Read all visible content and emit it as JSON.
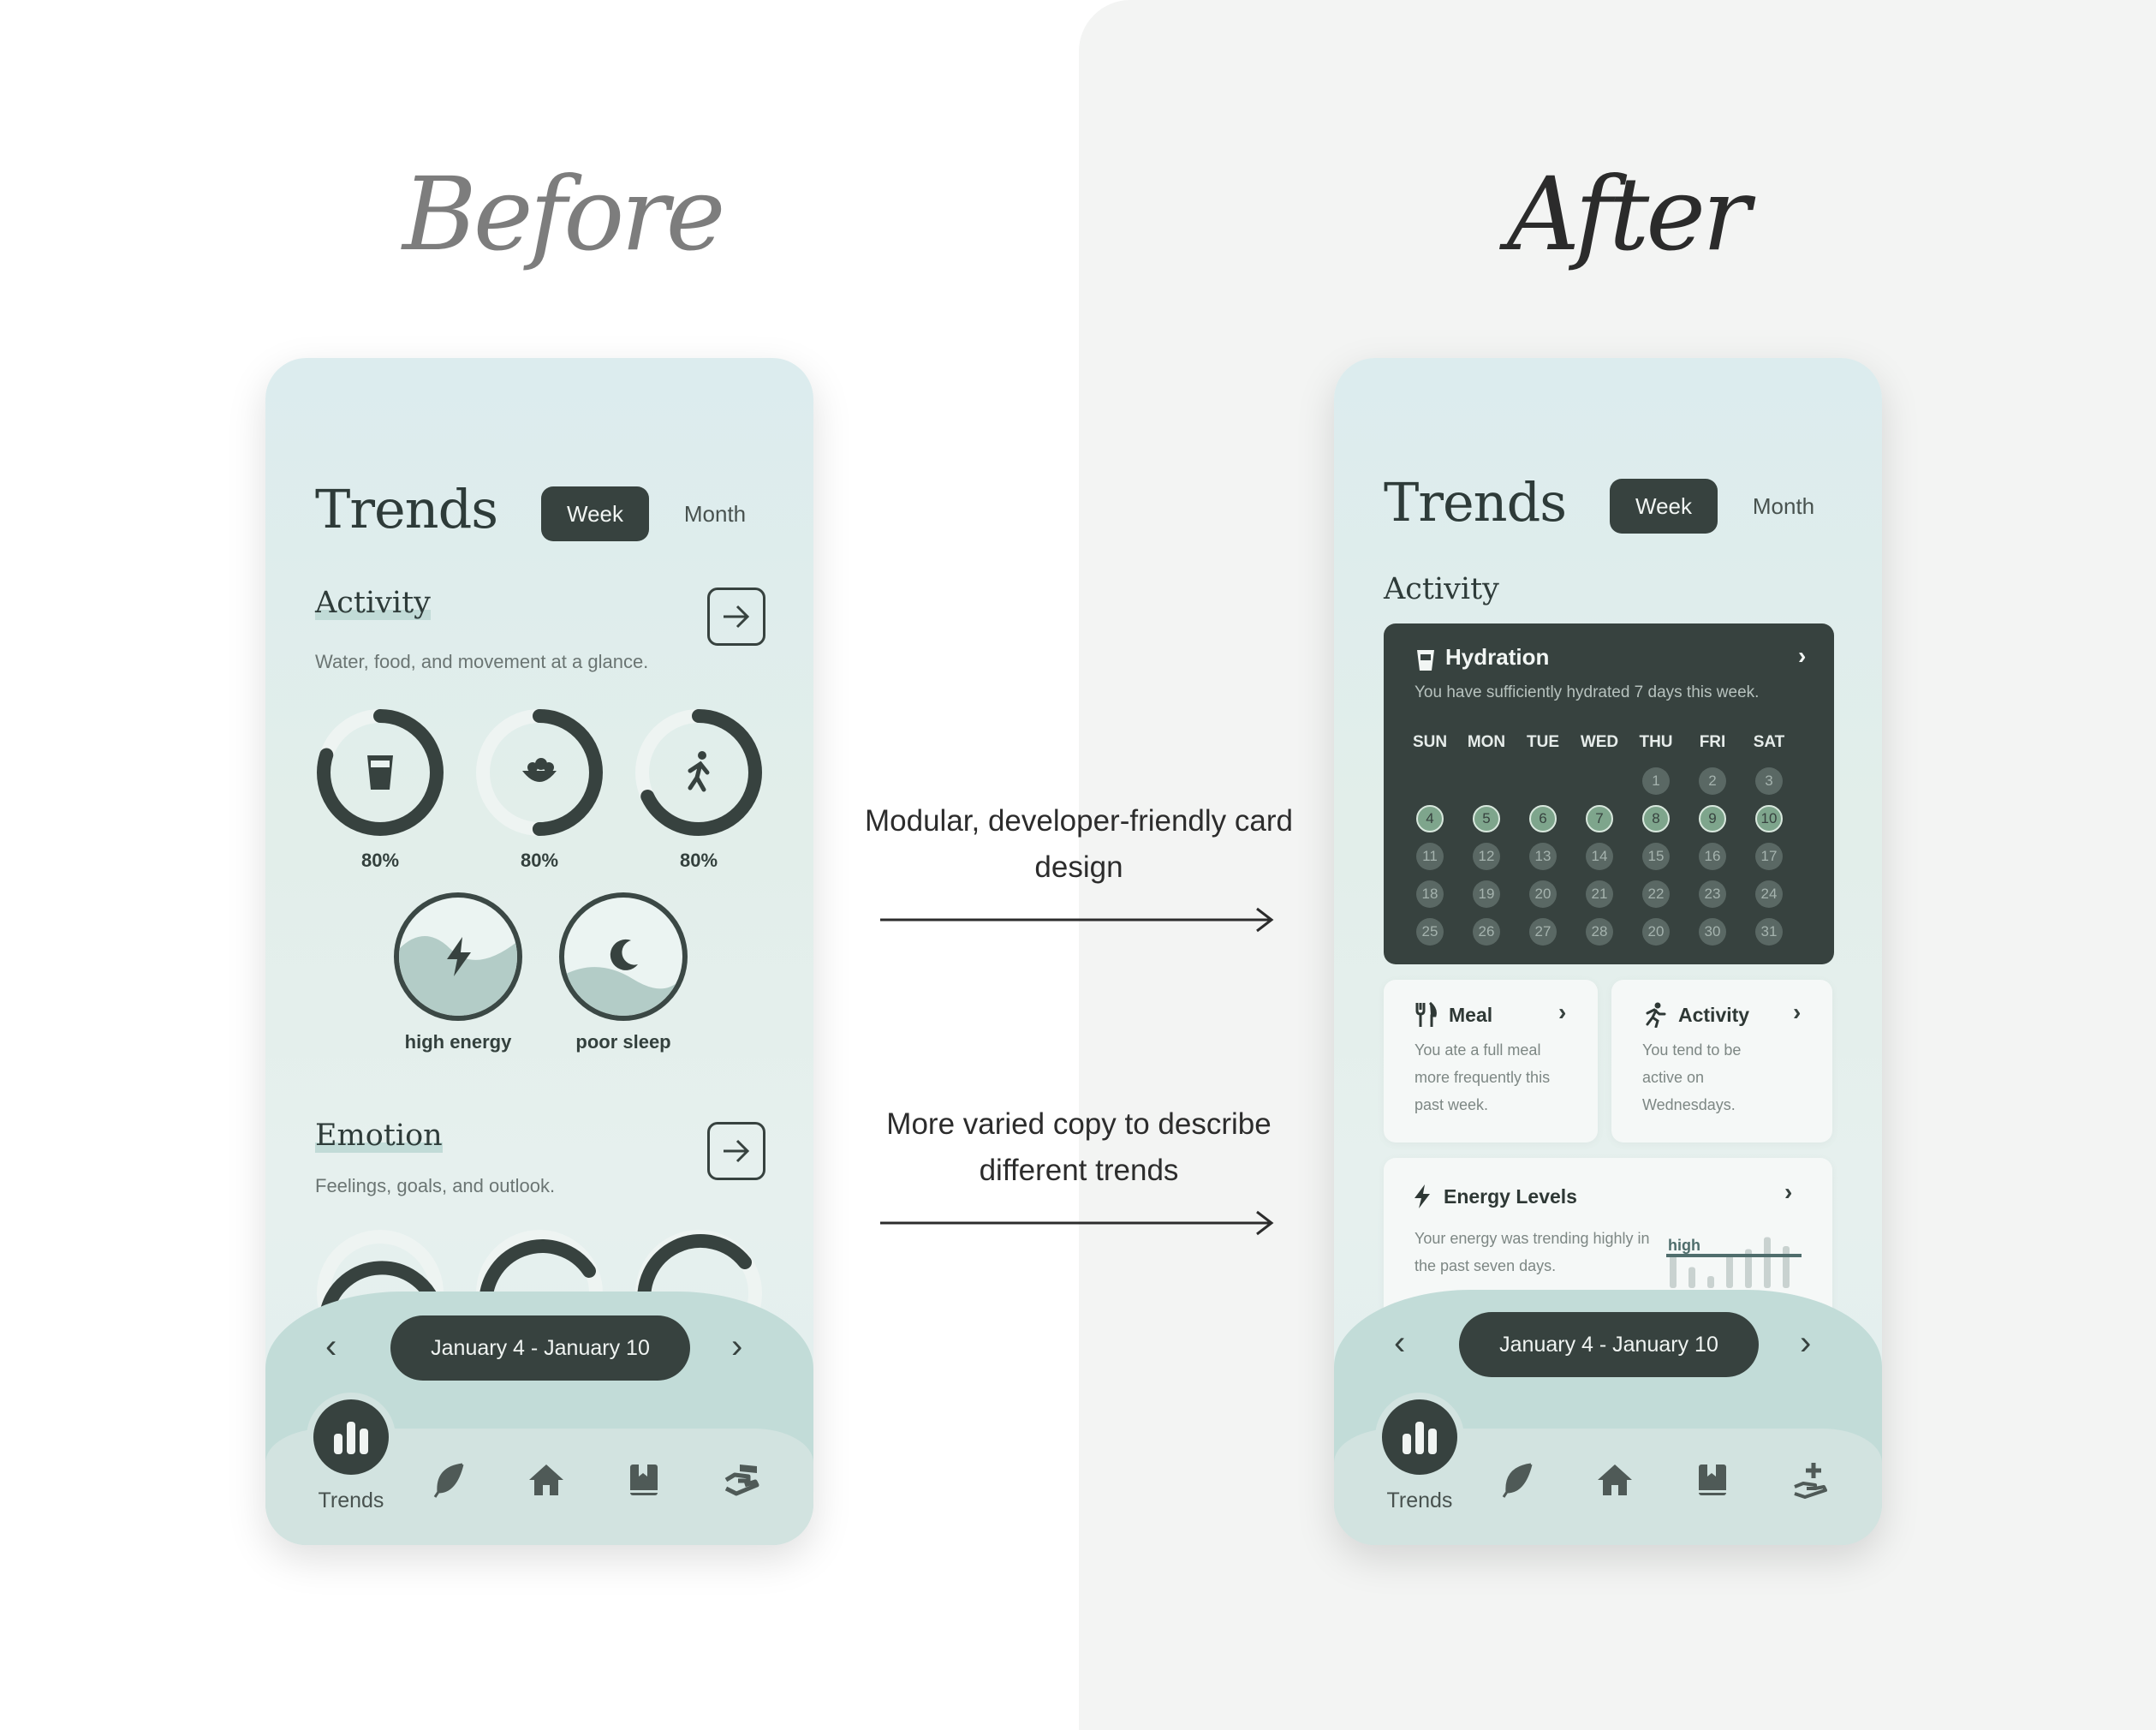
{
  "headings": {
    "before": "Before",
    "after": "After"
  },
  "captions": {
    "first": "Modular, developer-friendly card design",
    "second": "More varied copy to describe different trends"
  },
  "before": {
    "title": "Trends",
    "tabs": {
      "week": "Week",
      "month": "Month"
    },
    "activity": {
      "heading": "Activity",
      "subtitle": "Water, food, and movement at a glance.",
      "rings": [
        {
          "icon": "water-glass-icon",
          "label": "80%",
          "progress": 0.8
        },
        {
          "icon": "food-bowl-icon",
          "label": "80%",
          "progress": 0.5
        },
        {
          "icon": "walking-icon",
          "label": "80%",
          "progress": 0.68
        }
      ],
      "states": [
        {
          "icon": "lightning-icon",
          "label": "high energy"
        },
        {
          "icon": "moon-icon",
          "label": "poor sleep"
        }
      ]
    },
    "emotion": {
      "heading": "Emotion",
      "subtitle": "Feelings, goals, and outlook."
    },
    "date_range": "January 4 - January 10",
    "nav": {
      "active_label": "Trends"
    }
  },
  "after": {
    "title": "Trends",
    "tabs": {
      "week": "Week",
      "month": "Month"
    },
    "section": "Activity",
    "hydration": {
      "title": "Hydration",
      "subtitle": "You have sufficiently hydrated 7 days this week.",
      "days_of_week": [
        "SUN",
        "MON",
        "TUE",
        "WED",
        "THU",
        "FRI",
        "SAT"
      ],
      "calendar": [
        [
          "",
          "",
          "",
          "",
          "1",
          "2",
          "3"
        ],
        [
          "4",
          "5",
          "6",
          "7",
          "8",
          "9",
          "10"
        ],
        [
          "11",
          "12",
          "13",
          "14",
          "15",
          "16",
          "17"
        ],
        [
          "18",
          "19",
          "20",
          "21",
          "22",
          "23",
          "24"
        ],
        [
          "25",
          "26",
          "27",
          "28",
          "20",
          "30",
          "31"
        ]
      ],
      "hydrated_days": [
        "4",
        "5",
        "6",
        "7",
        "8",
        "9",
        "10"
      ]
    },
    "meal": {
      "title": "Meal",
      "body": "You ate a full meal more frequently this past week."
    },
    "activity_card": {
      "title": "Activity",
      "body": "You tend to be active on Wednesdays."
    },
    "energy": {
      "title": "Energy Levels",
      "body": "Your energy was trending highly in the past seven days.",
      "marker_label": "high",
      "bars": [
        0.55,
        0.35,
        0.2,
        0.55,
        0.65,
        0.85,
        0.7
      ]
    },
    "date_range": "January 4 - January 10",
    "nav": {
      "active_label": "Trends"
    }
  },
  "colors": {
    "dark": "#37423f",
    "accent_mint": "#c1dbd7",
    "hydrated": "#7ea58c",
    "panel": "#f3f4f3"
  }
}
